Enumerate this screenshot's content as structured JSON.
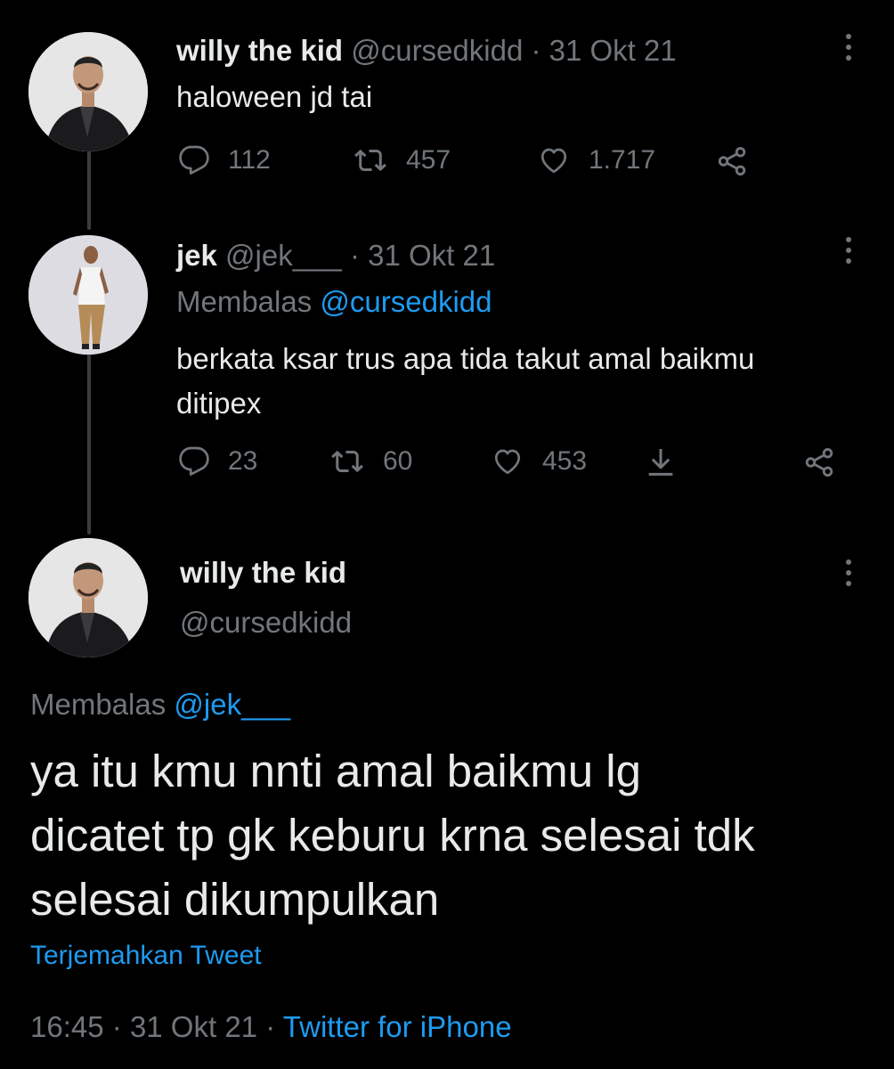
{
  "tweet1": {
    "name": "willy the kid",
    "handle": "@cursedkidd",
    "date": "· 31 Okt 21",
    "text": "haloween jd tai",
    "replies": "112",
    "retweets": "457",
    "likes": "1.717"
  },
  "tweet2": {
    "name": "jek",
    "handle": "@jek___",
    "date": "· 31 Okt 21",
    "reply_prefix": "Membalas",
    "reply_to": "@cursedkidd",
    "text_line1": "berkata ksar trus apa tida takut amal baikmu",
    "text_line2": "ditipex",
    "replies": "23",
    "retweets": "60",
    "likes": "453"
  },
  "main_tweet": {
    "name": "willy the kid",
    "handle": "@cursedkidd",
    "reply_prefix": "Membalas",
    "reply_to": "@jek___",
    "text_line1": "ya itu kmu nnti amal baikmu lg",
    "text_line2": "dicatet tp gk keburu krna selesai tdk",
    "text_line3": "selesai dikumpulkan",
    "translate": "Terjemahkan Tweet",
    "time": "16:45",
    "separator1": "·",
    "date": "31 Okt 21",
    "separator2": "·",
    "source": "Twitter for iPhone"
  },
  "icons": {
    "reply": "reply-icon",
    "retweet": "retweet-icon",
    "like": "heart-icon",
    "share": "share-icon",
    "download": "download-icon",
    "more": "more-vertical-icon"
  },
  "colors": {
    "background": "#000000",
    "text": "#e7e9ea",
    "muted": "#71767b",
    "link": "#1d9bf0"
  }
}
